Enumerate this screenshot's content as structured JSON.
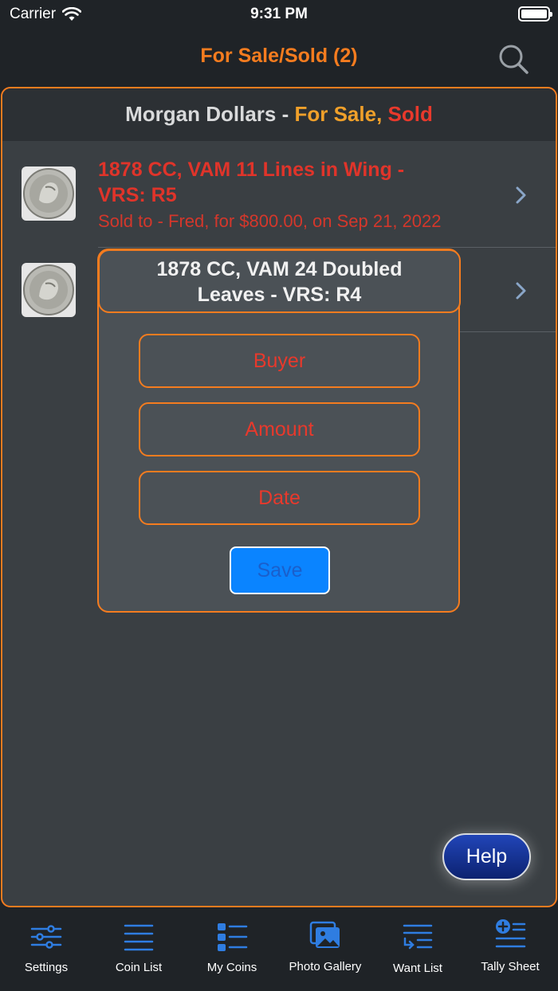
{
  "status_bar": {
    "carrier": "Carrier",
    "time": "9:31 PM"
  },
  "nav": {
    "title": "For Sale/Sold (2)"
  },
  "section": {
    "prefix": "Morgan Dollars - ",
    "for_sale": "For Sale,",
    "sold": " Sold"
  },
  "items": [
    {
      "title_line1": "1878 CC, VAM 11 Lines in Wing -",
      "title_line2": "VRS: R5",
      "subtitle": "Sold to - Fred, for $800.00, on Sep 21, 2022"
    }
  ],
  "modal": {
    "title_line1": "1878 CC, VAM 24 Doubled",
    "title_line2": "Leaves - VRS: R4",
    "buyer_placeholder": "Buyer",
    "amount_placeholder": "Amount",
    "date_placeholder": "Date",
    "save_label": "Save"
  },
  "help_label": "Help",
  "tabs": [
    {
      "label": "Settings",
      "icon": "sliders-icon"
    },
    {
      "label": "Coin List",
      "icon": "list-icon"
    },
    {
      "label": "My Coins",
      "icon": "grid-list-icon"
    },
    {
      "label": "Photo Gallery",
      "icon": "photos-icon"
    },
    {
      "label": "Want List",
      "icon": "want-list-icon"
    },
    {
      "label": "Tally Sheet",
      "icon": "tally-add-icon"
    }
  ],
  "colors": {
    "accent": "#f57c1f",
    "sold_red": "#e0342a",
    "tab_icon": "#2f7de1",
    "save_blue": "#0a84ff"
  }
}
